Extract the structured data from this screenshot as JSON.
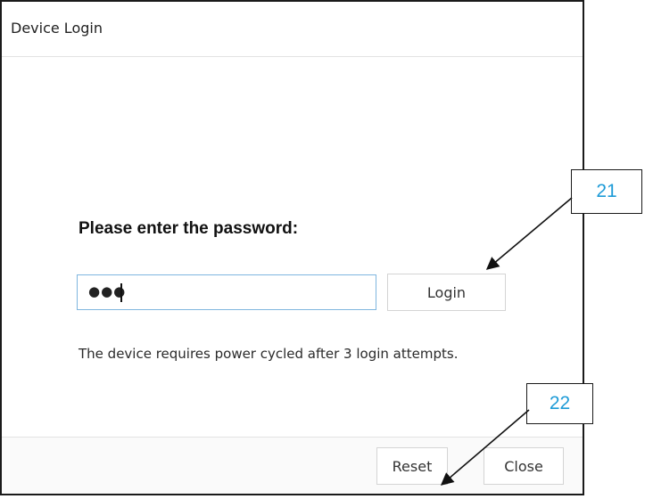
{
  "window": {
    "title": "Device Login"
  },
  "form": {
    "prompt": "Please enter the password:",
    "password_value": "●●●",
    "login_label": "Login",
    "hint": "The device requires power cycled after 3 login attempts."
  },
  "footer": {
    "reset_label": "Reset",
    "close_label": "Close"
  },
  "callouts": {
    "login": "21",
    "reset": "22"
  },
  "colors": {
    "callout_text": "#1e9bd7",
    "field_border_focus": "#7fb6df"
  }
}
